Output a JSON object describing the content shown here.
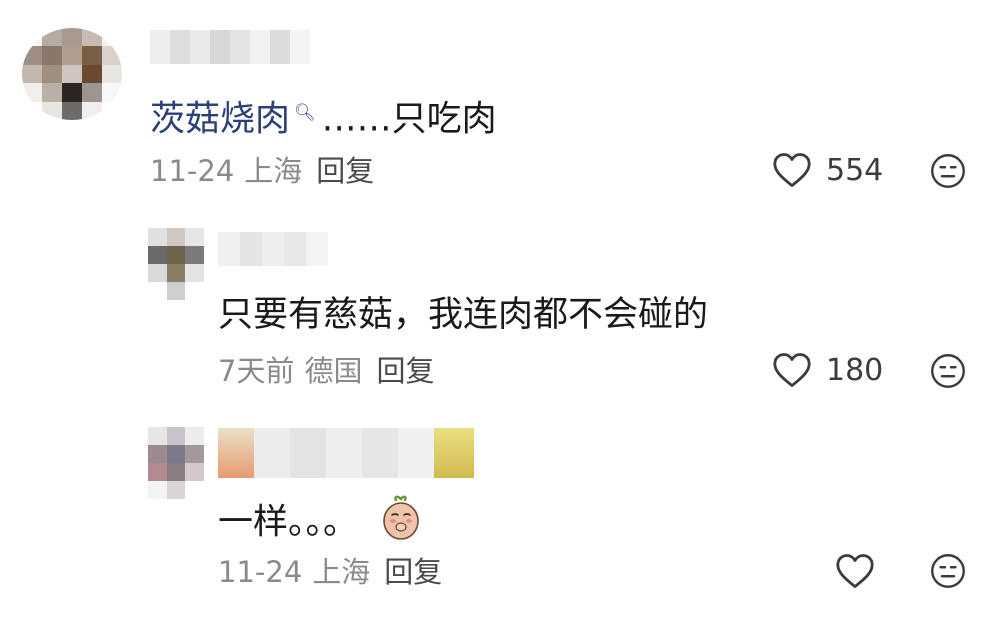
{
  "comments": [
    {
      "text_link": "茨菇烧肉",
      "search_icon": "search-icon",
      "text_rest": "……只吃肉",
      "date": "11-24",
      "location": "上海",
      "reply_label": "回复",
      "likes": "554"
    },
    {
      "text": "只要有慈菇，我连肉都不会碰的",
      "date": "7天前",
      "location": "德国",
      "reply_label": "回复",
      "likes": "180"
    },
    {
      "text": "一样。。。",
      "sticker": "blushing-potato-sticker",
      "date": "11-24",
      "location": "上海",
      "reply_label": "回复",
      "likes": ""
    }
  ],
  "colors": {
    "link": "#2b3f7a",
    "meta": "#8a8a8a",
    "text": "#1a1a1a"
  },
  "icons": [
    "heart-outline-icon",
    "dislike-face-icon"
  ]
}
